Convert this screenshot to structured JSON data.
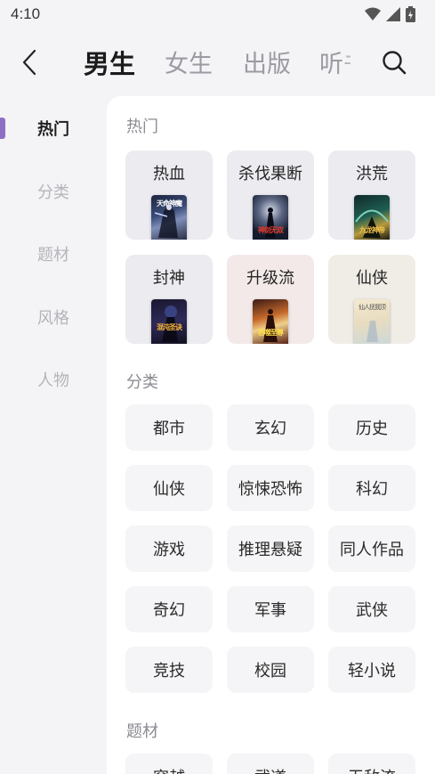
{
  "status": {
    "time": "4:10"
  },
  "nav": {
    "tabs": [
      {
        "label": "男生",
        "active": true
      },
      {
        "label": "女生",
        "active": false
      },
      {
        "label": "出版",
        "active": false
      },
      {
        "label": "听书",
        "active": false
      }
    ]
  },
  "sidebar": {
    "items": [
      {
        "label": "热门",
        "active": true
      },
      {
        "label": "分类",
        "active": false
      },
      {
        "label": "题材",
        "active": false
      },
      {
        "label": "风格",
        "active": false
      },
      {
        "label": "人物",
        "active": false
      }
    ]
  },
  "sections": {
    "hot": {
      "title": "热门",
      "cards": [
        {
          "label": "热血",
          "cover_text": "天命神魔",
          "bg": "#ebebf0"
        },
        {
          "label": "杀伐果断",
          "cover_text": "神剑无双",
          "bg": "#ebebf0"
        },
        {
          "label": "洪荒",
          "cover_text": "九龙神帝",
          "bg": "#ebebf0"
        },
        {
          "label": "封神",
          "cover_text": "混沌圣诀",
          "bg": "#ebebf0"
        },
        {
          "label": "升级流",
          "cover_text": "吞噬至尊",
          "bg": "#f2e9e8"
        },
        {
          "label": "仙侠",
          "cover_text": "仙人抚我顶",
          "bg": "#efede6"
        }
      ]
    },
    "category": {
      "title": "分类",
      "items": [
        "都市",
        "玄幻",
        "历史",
        "仙侠",
        "惊悚恐怖",
        "科幻",
        "游戏",
        "推理悬疑",
        "同人作品",
        "奇幻",
        "军事",
        "武侠",
        "竞技",
        "校园",
        "轻小说"
      ]
    },
    "theme": {
      "title": "题材",
      "items": [
        "穿越",
        "武道",
        "无敌流"
      ]
    }
  }
}
